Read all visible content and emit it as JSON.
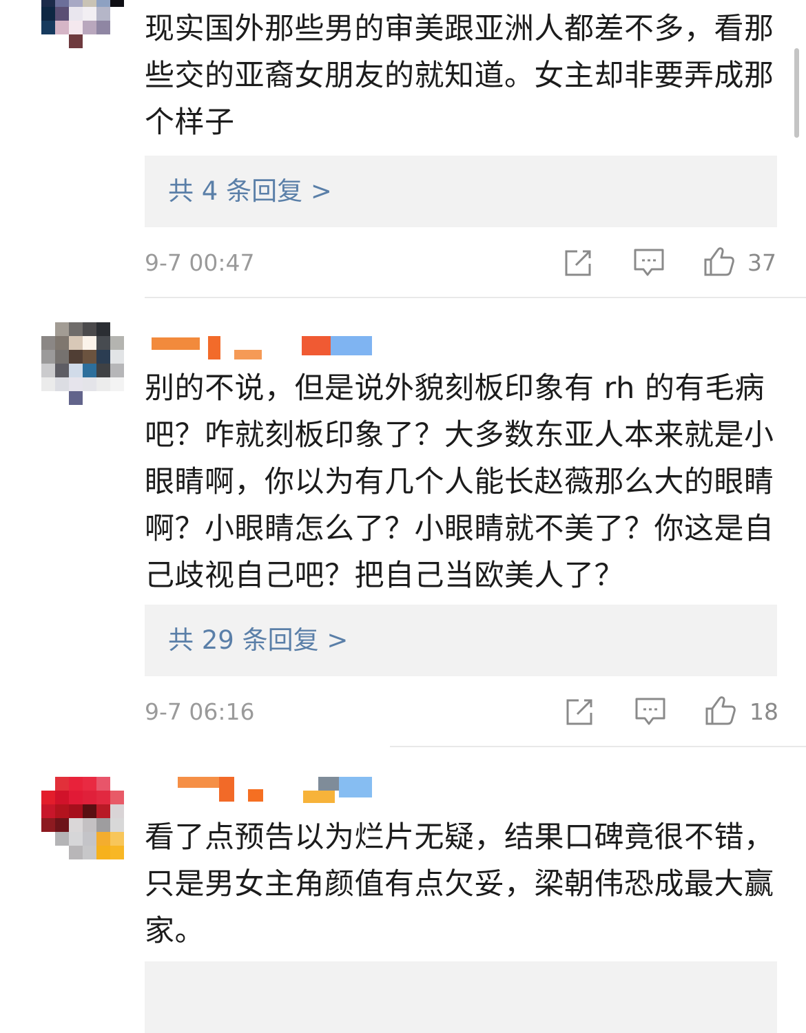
{
  "comments": [
    {
      "text": "现实国外那些男的审美跟亚洲人都差不多，看那些交的亚裔女朋友的就知道。女主却非要弄成那个样子",
      "replies_label": "共 4 条回复 >",
      "timestamp": "9-7 00:47",
      "likes": "37",
      "share_icon": "share-icon",
      "comment_icon": "comment-icon",
      "like_icon": "thumbs-up-icon"
    },
    {
      "text": "别的不说，但是说外貌刻板印象有 rh 的有毛病吧？咋就刻板印象了？大多数东亚人本来就是小眼睛啊，你以为有几个人能长赵薇那么大的眼睛啊？小眼睛怎么了？小眼睛就不美了？你这是自己歧视自己吧？把自己当欧美人了？",
      "replies_label": "共 29 条回复 >",
      "timestamp": "9-7 06:16",
      "likes": "18",
      "share_icon": "share-icon",
      "comment_icon": "comment-icon",
      "like_icon": "thumbs-up-icon"
    },
    {
      "text": "看了点预告以为烂片无疑，结果口碑竟很不错，只是男女主角颜值有点欠妥，梁朝伟恐成最大赢家。"
    }
  ],
  "colors": {
    "link": "#5a7fa8",
    "meta": "#9a9a9a",
    "reply_bg": "#f2f2f2",
    "divider": "#e8e8e8"
  }
}
